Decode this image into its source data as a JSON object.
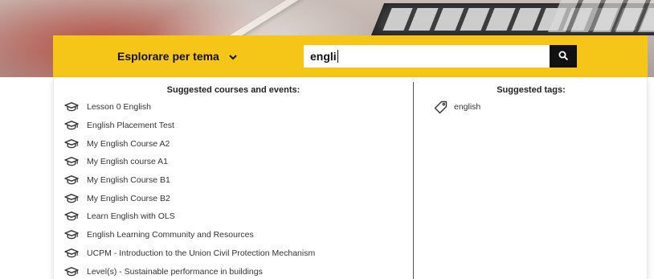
{
  "search": {
    "theme_label": "Esplorare per tema",
    "query": "engli"
  },
  "suggestions": {
    "courses_title": "Suggested courses and events:",
    "courses": [
      "Lesson 0 English",
      "English Placement Test",
      "My English Course A2",
      "My English course A1",
      "My English Course B1",
      "My English Course B2",
      "Learn English with OLS",
      "English Learning Community and Resources",
      "UCPM - Introduction to the Union Civil Protection Mechanism",
      "Level(s) - Sustainable performance in buildings"
    ],
    "tags_title": "Suggested tags:",
    "tags": [
      "english"
    ]
  },
  "icons": {
    "course": "graduation-cap-icon",
    "tag": "tag-icon",
    "search": "search-icon",
    "dropdown": "chevron-down-icon"
  },
  "colors": {
    "accent": "#f5c518",
    "search_button": "#111111"
  }
}
